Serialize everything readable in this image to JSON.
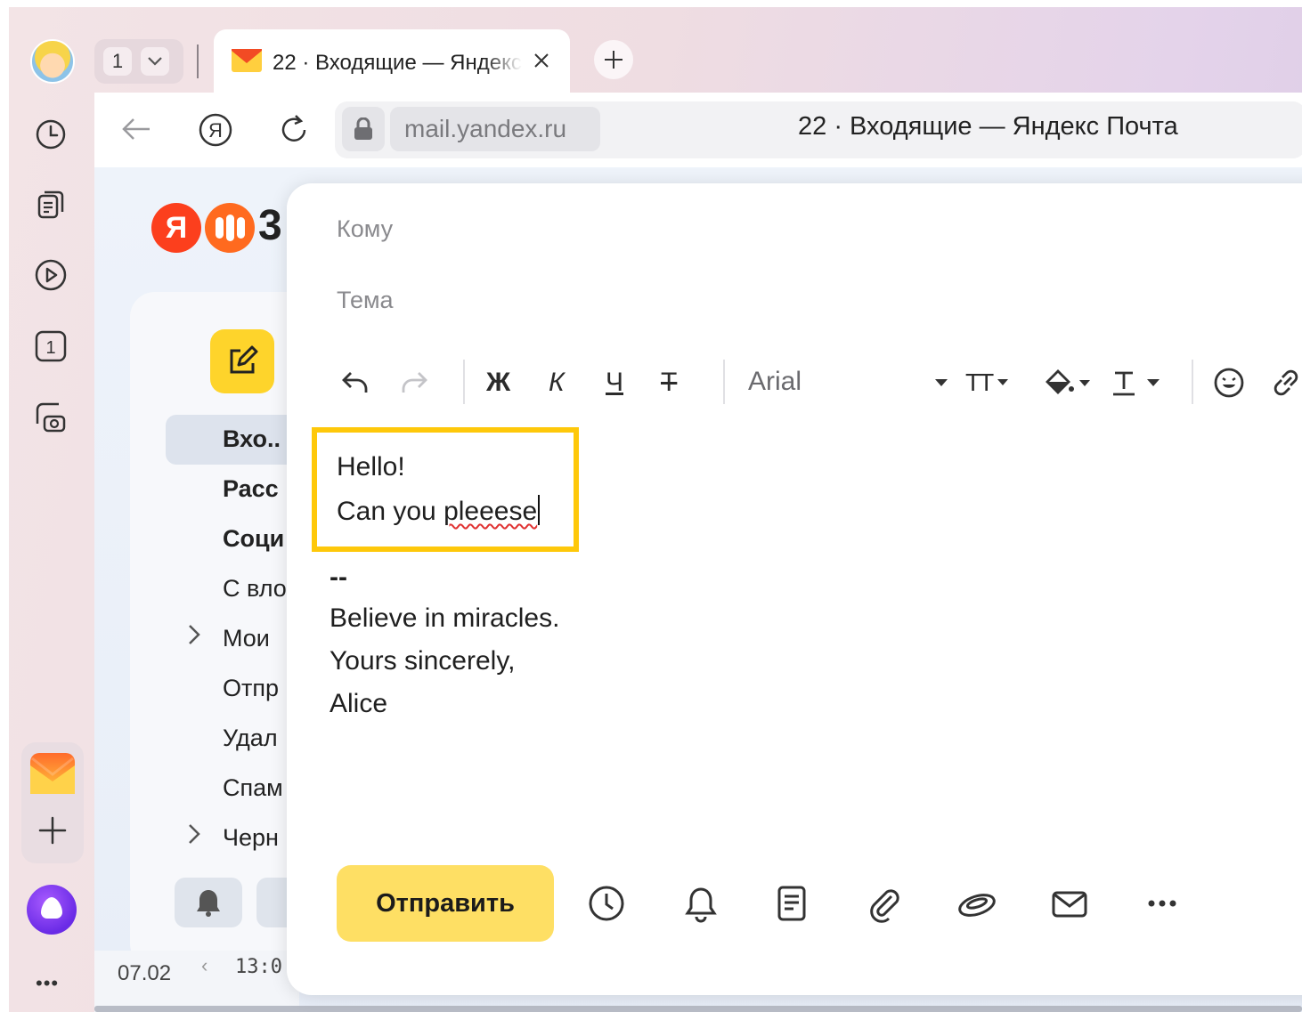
{
  "browser": {
    "tab_count": "1",
    "tab_title": "22 · Входящие — Яндекс Почта",
    "url_domain": "mail.yandex.ru",
    "page_title": "22 · Входящие — Яндекс Почта",
    "sidebar_icons": [
      "history-icon",
      "tabs-icon",
      "video-icon",
      "calendar-icon",
      "screenshot-icon"
    ],
    "sidebar_calendar_day": "1"
  },
  "mail": {
    "logo_letter": "Я",
    "logo_tail": "3",
    "folders": [
      {
        "label": "Вхо..",
        "bold": true,
        "active": true
      },
      {
        "label": "Расс",
        "bold": true
      },
      {
        "label": "Соци",
        "bold": true
      },
      {
        "label": "С вло",
        "bold": false
      },
      {
        "label": "Мои",
        "bold": false,
        "expandable": true
      },
      {
        "label": "Отпр",
        "bold": false
      },
      {
        "label": "Удал",
        "bold": false
      },
      {
        "label": "Спам",
        "bold": false
      },
      {
        "label": "Черн",
        "bold": false,
        "expandable": true
      }
    ],
    "date_label": "07.02",
    "time_label": "13:0"
  },
  "compose": {
    "to_label": "Кому",
    "subject_label": "Тема",
    "format": {
      "bold": "Ж",
      "italic": "К",
      "underline": "Ч",
      "strike": "Т",
      "font": "Arial",
      "size_label": "TT"
    },
    "body_lines": [
      "Hello!",
      "Can you "
    ],
    "misspelled_word": "pleeese",
    "signature": [
      "--",
      "Believe in miracles.",
      "Yours sincerely,",
      "Alice"
    ],
    "send_label": "Отправить",
    "actions": [
      "clock-icon",
      "bell-icon",
      "template-icon",
      "attach-icon",
      "disk-icon",
      "mail-icon",
      "more-icon"
    ],
    "highlight_color": "#fec80a"
  }
}
